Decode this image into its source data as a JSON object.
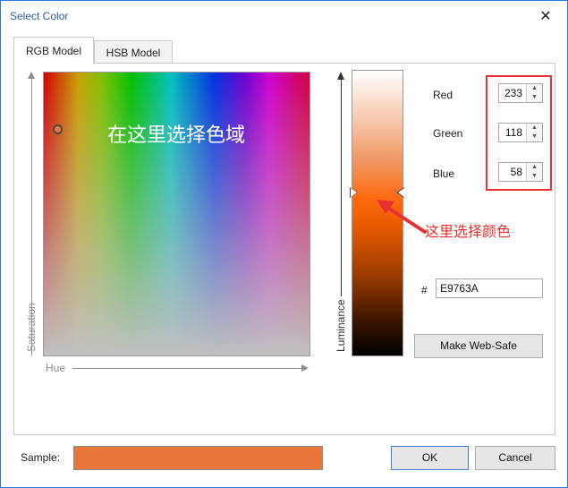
{
  "window": {
    "title": "Select Color"
  },
  "tabs": [
    {
      "label": "RGB Model",
      "active": true
    },
    {
      "label": "HSB Model",
      "active": false
    }
  ],
  "hue_field": {
    "annotation": "在这里选择色域",
    "saturation_label": "Saturation",
    "hue_label": "Hue"
  },
  "luminance": {
    "label": "Luminance",
    "annotation": "这里选择颜色"
  },
  "rgb": {
    "red": {
      "label": "Red",
      "value": "233"
    },
    "green": {
      "label": "Green",
      "value": "118"
    },
    "blue": {
      "label": "Blue",
      "value": "58"
    }
  },
  "hex": {
    "symbol": "#",
    "value": "E9763A"
  },
  "buttons": {
    "websafe": "Make Web-Safe",
    "ok": "OK",
    "cancel": "Cancel"
  },
  "sample": {
    "label": "Sample:",
    "color": "#e9763a"
  },
  "icons": {
    "close": "close-icon",
    "spin_up": "chevron-up-icon",
    "spin_down": "chevron-down-icon"
  },
  "colors": {
    "accent": "#2b79d8",
    "annotation_red": "#e53131",
    "selected_color": "#e9763a"
  }
}
